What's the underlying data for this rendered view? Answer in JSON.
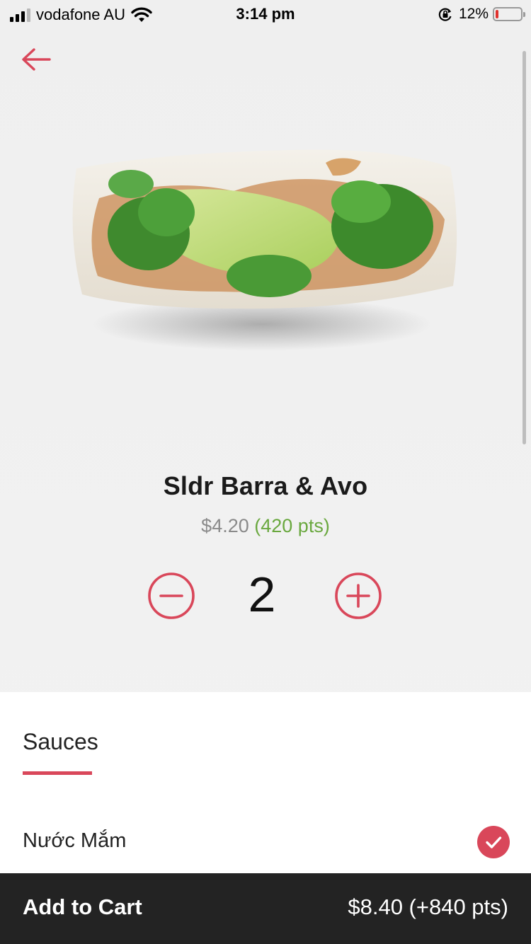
{
  "status_bar": {
    "carrier": "vodafone AU",
    "time": "3:14 pm",
    "battery_percent": "12%",
    "battery_level": 0.12,
    "battery_color": "#e0322f"
  },
  "navigation": {
    "back_icon": "arrow-left-icon",
    "accent_color": "#d9475a"
  },
  "product": {
    "image_icon": "rice-paper-roll-image",
    "name": "Sldr Barra & Avo",
    "price": "$4.20",
    "points": "(420 pts)",
    "points_color": "#6aa83f"
  },
  "quantity": {
    "decrement_icon": "minus-circle-icon",
    "value": "2",
    "increment_icon": "plus-circle-icon"
  },
  "options": {
    "active_tab": "Sauces",
    "items": [
      {
        "label": "Nước Mắm",
        "selected": true,
        "icon": "check-circle-icon"
      }
    ]
  },
  "cart": {
    "label": "Add to Cart",
    "total": "$8.40 (+840 pts)"
  }
}
